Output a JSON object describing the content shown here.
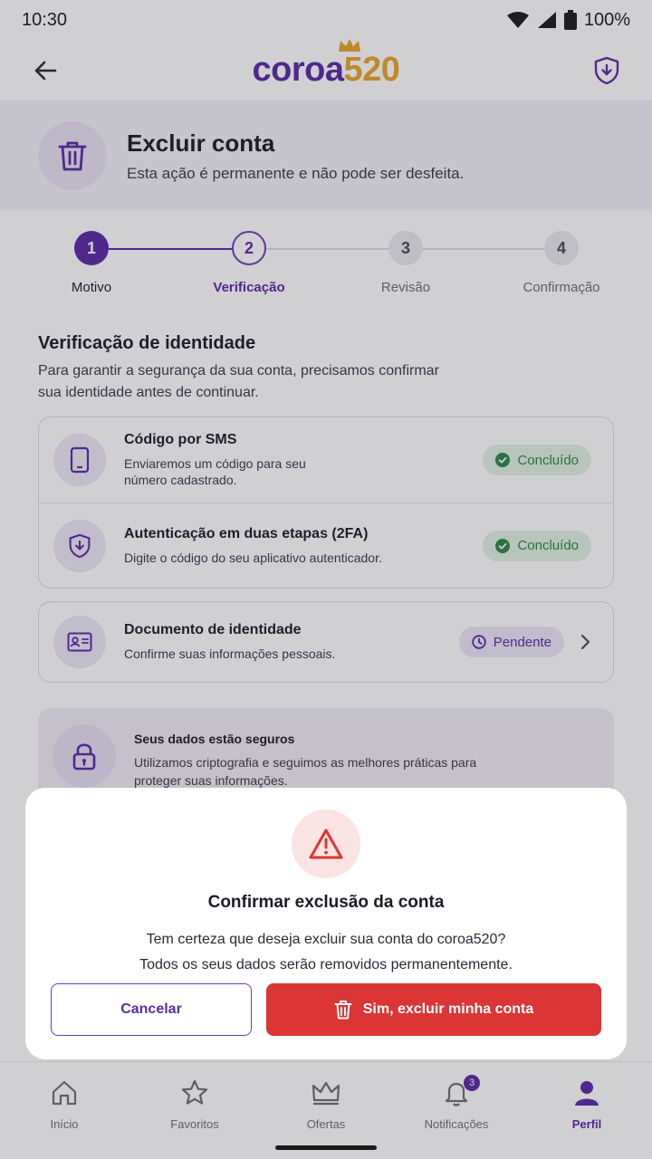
{
  "status_bar": {
    "time": "10:30",
    "battery": "100%"
  },
  "header": {
    "back_icon": "arrow-left-icon",
    "logo_part1": "coroa",
    "logo_part2": "520",
    "shield_icon": "shield-download-icon"
  },
  "page": {
    "title": "Excluir conta",
    "subtitle": "Esta ação é permanente e não pode ser desfeita."
  },
  "stepper": {
    "steps": [
      {
        "number": "1",
        "label": "Motivo",
        "state": "done"
      },
      {
        "number": "2",
        "label": "Verificação",
        "state": "current"
      },
      {
        "number": "3",
        "label": "Revisão",
        "state": "todo"
      },
      {
        "number": "4",
        "label": "Confirmação",
        "state": "todo"
      }
    ]
  },
  "verification": {
    "title": "Verificação de identidade",
    "description": "Para garantir a segurança da sua conta, precisamos confirmar sua identidade antes de continuar.",
    "methods": [
      {
        "title": "Código por SMS",
        "subtitle": "Enviaremos um código para seu número cadastrado.",
        "status": "Concluído",
        "icon": "phone-icon"
      },
      {
        "title": "Autenticação em duas etapas (2FA)",
        "subtitle": "Digite o código do seu aplicativo autenticador.",
        "status": "Concluído",
        "icon": "shield-icon"
      }
    ],
    "document": {
      "title": "Documento de identidade",
      "subtitle": "Confirme suas informações pessoais.",
      "status": "Pendente",
      "icon": "id-card-icon"
    }
  },
  "security_note": {
    "title": "Seus dados estão seguros",
    "text": "Utilizamos criptografia e seguimos as melhores práticas para proteger suas informações."
  },
  "dialog": {
    "title": "Confirmar exclusão da conta",
    "message_line1": "Tem certeza que deseja excluir sua conta do coroa520?",
    "message_line2": "Todos os seus dados serão removidos permanentemente.",
    "cancel_label": "Cancelar",
    "confirm_label": "Sim, excluir minha conta"
  },
  "bottom_nav": {
    "items": [
      {
        "label": "Início",
        "icon": "home-icon"
      },
      {
        "label": "Favoritos",
        "icon": "star-icon"
      },
      {
        "label": "Ofertas",
        "icon": "crown-icon"
      },
      {
        "label": "Notificações",
        "icon": "bell-icon",
        "badge": "3"
      },
      {
        "label": "Perfil",
        "icon": "person-icon",
        "active": true
      }
    ]
  },
  "colors": {
    "brand_purple": "#5b2aa6",
    "brand_gold": "#e8a628",
    "danger_red": "#dc3535",
    "success_green": "#2c8a43"
  }
}
